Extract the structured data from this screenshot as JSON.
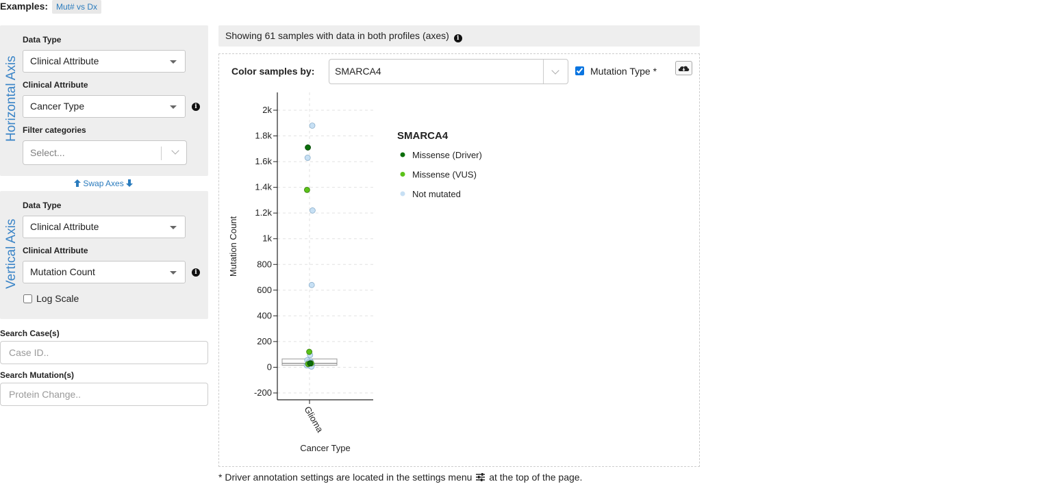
{
  "examples": {
    "label": "Examples:",
    "chip": "Mut# vs Dx"
  },
  "horizontal_axis": {
    "title": "Horizontal Axis",
    "data_type_label": "Data Type",
    "data_type_value": "Clinical Attribute",
    "attribute_label": "Clinical Attribute",
    "attribute_value": "Cancer Type",
    "filter_label": "Filter categories",
    "filter_placeholder": "Select..."
  },
  "swap_axes": "Swap Axes",
  "vertical_axis": {
    "title": "Vertical Axis",
    "data_type_label": "Data Type",
    "data_type_value": "Clinical Attribute",
    "attribute_label": "Clinical Attribute",
    "attribute_value": "Mutation Count",
    "log_scale_label": "Log Scale",
    "log_scale_checked": false
  },
  "search_case": {
    "label": "Search Case(s)",
    "placeholder": "Case ID.."
  },
  "search_mutation": {
    "label": "Search Mutation(s)",
    "placeholder": "Protein Change.."
  },
  "status": "Showing 61 samples with data in both profiles (axes)",
  "color_by": {
    "label": "Color samples by:",
    "value": "SMARCA4",
    "mutation_type_label": "Mutation Type *",
    "mutation_type_checked": true
  },
  "footnote": {
    "before": "* Driver annotation settings are located in the settings menu",
    "after": "at the top of the page."
  },
  "icons": [
    "info-icon",
    "arrow-up-icon",
    "arrow-down-icon",
    "cloud-download-icon",
    "sliders-icon",
    "chevron-down-icon"
  ],
  "colors": {
    "axis_title_blue": "#3a84c7",
    "driver": "#0b6e0b",
    "vus": "#5bc219",
    "not_mutated": "#c7e0f4",
    "not_mutated_stroke": "#8aaecb"
  },
  "chart_data": {
    "type": "scatter",
    "xlabel": "Cancer Type",
    "ylabel": "Mutation Count",
    "categories": [
      "Glioma"
    ],
    "ylim": [
      -250,
      2100
    ],
    "yticks": [
      -200,
      0,
      200,
      400,
      600,
      800,
      1000,
      1200,
      1400,
      1600,
      1800,
      2000
    ],
    "ytick_labels": [
      "-200",
      "0",
      "200",
      "400",
      "600",
      "800",
      "1k",
      "1.2k",
      "1.4k",
      "1.6k",
      "1.8k",
      "2k"
    ],
    "grid": true,
    "legend": {
      "title": "SMARCA4",
      "position": "right",
      "entries": [
        "Missense (Driver)",
        "Missense (VUS)",
        "Not mutated"
      ]
    },
    "boxplot": {
      "category": "Glioma",
      "q1": 15,
      "median": 30,
      "q3": 65
    },
    "series": [
      {
        "name": "Missense (Driver)",
        "x_offsets": [
          -0.3,
          0.1
        ],
        "values": [
          1710,
          30
        ]
      },
      {
        "name": "Missense (VUS)",
        "x_offsets": [
          -0.45,
          -0.05,
          0.3,
          -0.25
        ],
        "values": [
          1380,
          120,
          30,
          25
        ]
      },
      {
        "name": "Not mutated",
        "x_offsets": [
          0.5,
          -0.35,
          0.55,
          0.4,
          0.1,
          -0.4,
          0.2,
          -0.1,
          0.3,
          0.0,
          -0.2,
          0.45,
          -0.5,
          0.15,
          0.35
        ],
        "values": [
          1880,
          1630,
          1220,
          640,
          95,
          55,
          45,
          40,
          35,
          30,
          25,
          20,
          15,
          10,
          5
        ]
      }
    ]
  }
}
